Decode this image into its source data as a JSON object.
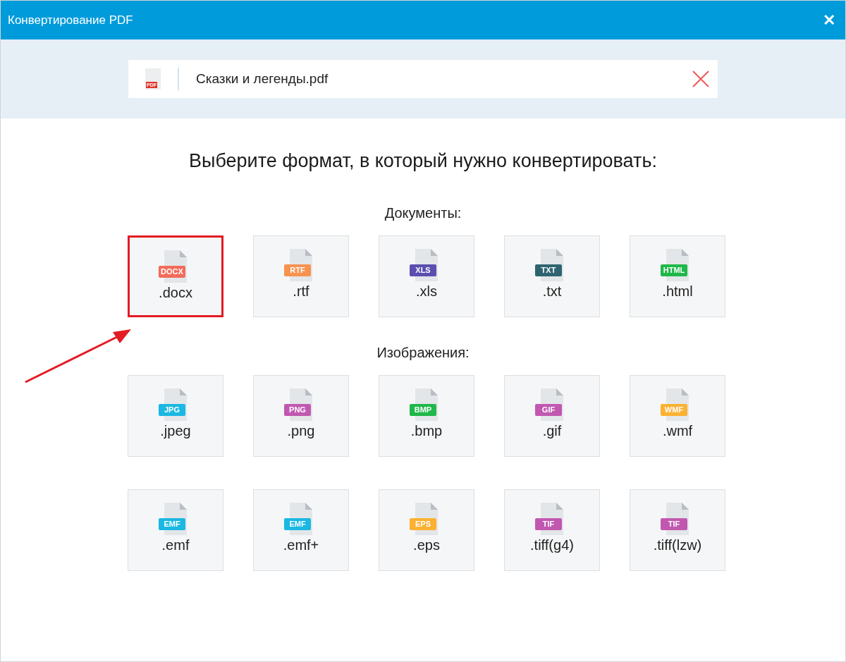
{
  "window": {
    "title": "Конвертирование PDF",
    "close": "✕"
  },
  "file": {
    "name": "Сказки и легенды.pdf",
    "icon_label": "PDF"
  },
  "heading": "Выберите формат, в который нужно конвертировать:",
  "sections": [
    {
      "title": "Документы:",
      "items": [
        {
          "tag": "DOCX",
          "label": ".docx",
          "color": "#f26b5b",
          "selected": true
        },
        {
          "tag": "RTF",
          "label": ".rtf",
          "color": "#f7924f",
          "selected": false
        },
        {
          "tag": "XLS",
          "label": ".xls",
          "color": "#5a4fb0",
          "selected": false
        },
        {
          "tag": "TXT",
          "label": ".txt",
          "color": "#2e6470",
          "selected": false
        },
        {
          "tag": "HTML",
          "label": ".html",
          "color": "#1fb84a",
          "selected": false
        }
      ]
    },
    {
      "title": "Изображения:",
      "items": [
        {
          "tag": "JPG",
          "label": ".jpeg",
          "color": "#1ab8e2",
          "selected": false
        },
        {
          "tag": "PNG",
          "label": ".png",
          "color": "#c158b0",
          "selected": false
        },
        {
          "tag": "BMP",
          "label": ".bmp",
          "color": "#1fb84a",
          "selected": false
        },
        {
          "tag": "GIF",
          "label": ".gif",
          "color": "#c158b0",
          "selected": false
        },
        {
          "tag": "WMF",
          "label": ".wmf",
          "color": "#fbb131",
          "selected": false
        },
        {
          "tag": "EMF",
          "label": ".emf",
          "color": "#1ab8e2",
          "selected": false
        },
        {
          "tag": "EMF",
          "label": ".emf+",
          "color": "#1ab8e2",
          "selected": false
        },
        {
          "tag": "EPS",
          "label": ".eps",
          "color": "#fbb131",
          "selected": false
        },
        {
          "tag": "TIF",
          "label": ".tiff(g4)",
          "color": "#c158b0",
          "selected": false
        },
        {
          "tag": "TIF",
          "label": ".tiff(lzw)",
          "color": "#c158b0",
          "selected": false
        }
      ]
    }
  ]
}
